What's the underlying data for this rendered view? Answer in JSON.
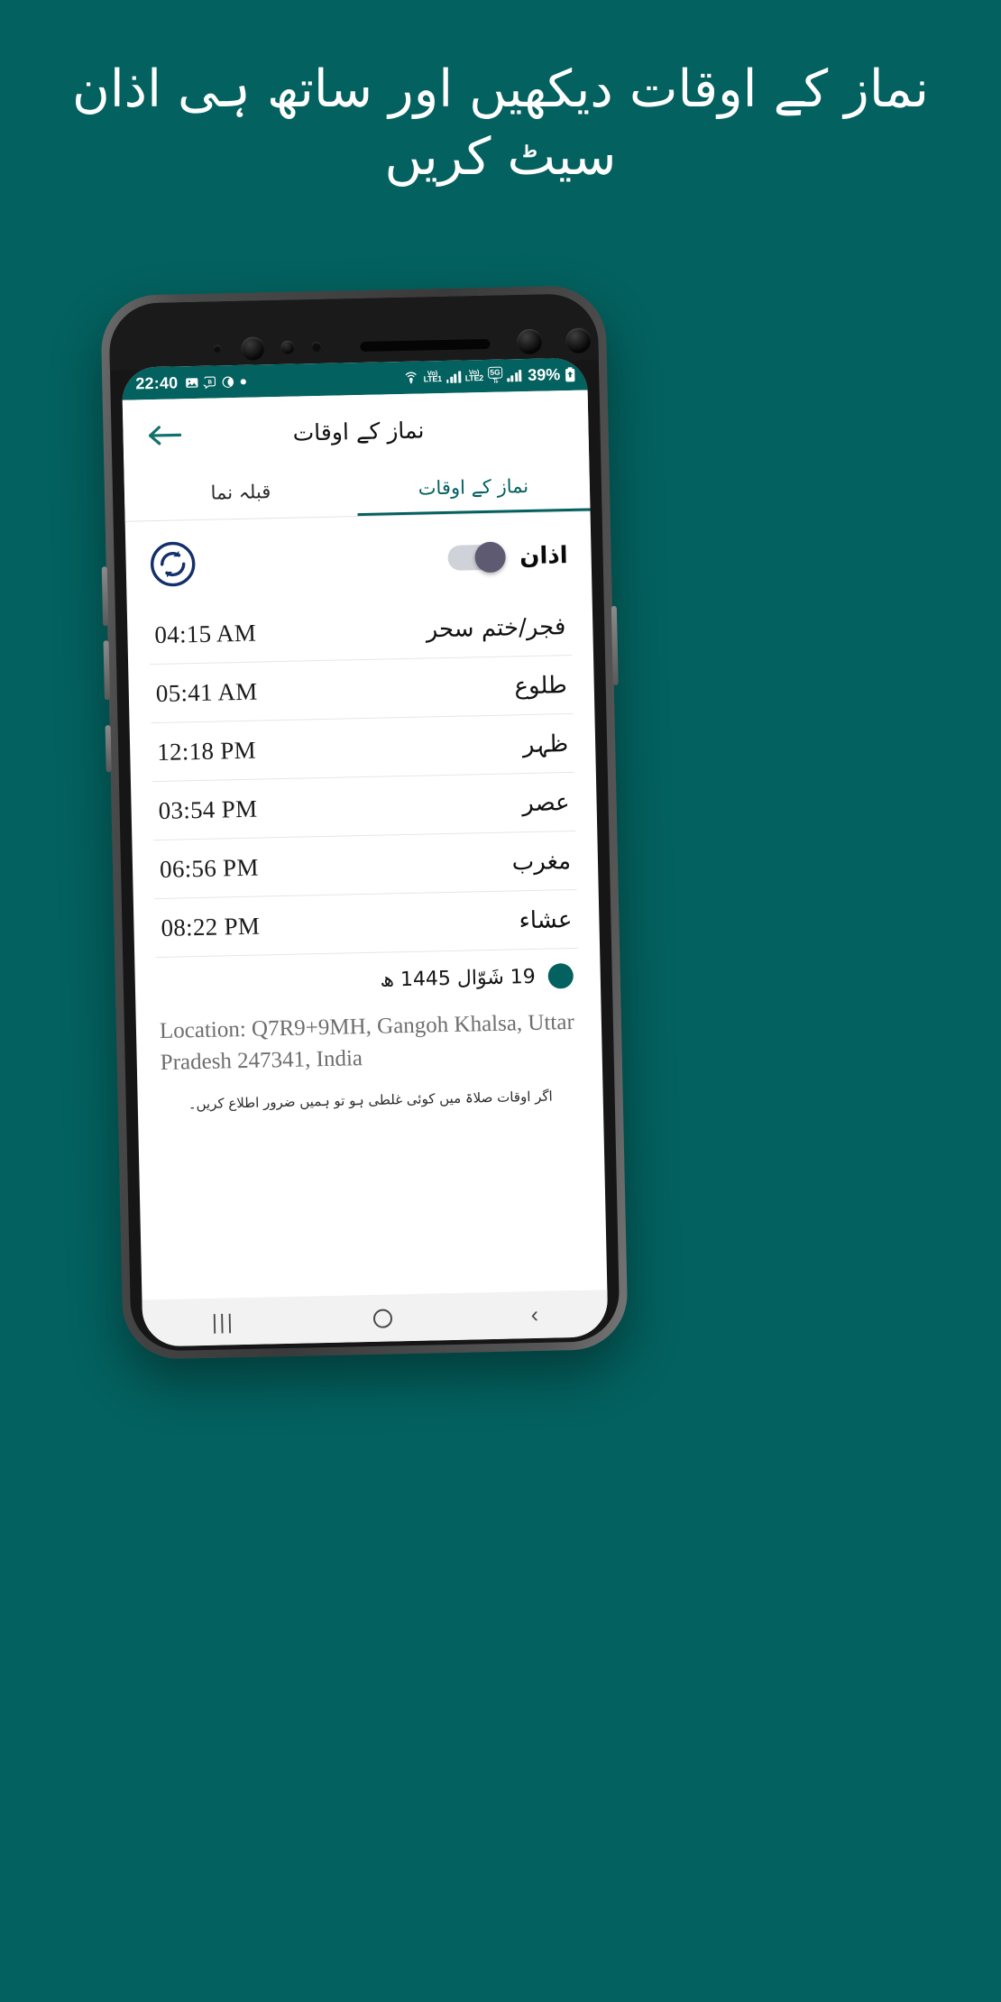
{
  "promo": {
    "headline": "نماز کے اوقات دیکھیں اور ساتھ ہی اذان سیٹ کریں",
    "background_color": "#03615f"
  },
  "statusbar": {
    "clock": "22:40",
    "left_icons": [
      "image-icon",
      "b-badge-icon",
      "moon-icon",
      "dot-icon"
    ],
    "network_1": {
      "line1": "Vo)",
      "line2": "LTE1"
    },
    "network_2": {
      "line1": "Vo)",
      "line2": "LTE2"
    },
    "data_badge": "5G",
    "battery_percent": "39%",
    "right_icons": [
      "hotspot-icon",
      "signal-bars-icon",
      "battery-icon"
    ]
  },
  "appbar": {
    "title": "نماز کے اوقات",
    "back_icon": "arrow-left-icon"
  },
  "tabs": [
    {
      "label": "نماز کے اوقات",
      "active": true
    },
    {
      "label": "قبلہ نما",
      "active": false
    }
  ],
  "azan": {
    "label": "اذان",
    "toggle_state": "on",
    "refresh_icon": "refresh-sync-icon"
  },
  "prayers": [
    {
      "name": "فجر/ختم سحر",
      "time": "04:15 AM"
    },
    {
      "name": "طلوع",
      "time": "05:41 AM"
    },
    {
      "name": "ظہر",
      "time": "12:18 PM"
    },
    {
      "name": "عصر",
      "time": "03:54 PM"
    },
    {
      "name": "مغرب",
      "time": "06:56 PM"
    },
    {
      "name": "عشاء",
      "time": "08:22 PM"
    }
  ],
  "hijri": {
    "date": "19 شَوّال 1445 ھ"
  },
  "location": {
    "text": "Location: Q7R9+9MH, Gangoh Khalsa, Uttar Pradesh 247341, India"
  },
  "note": {
    "text": "اگر اوقات صلاۃ میں کوئی غلطی ہو تو ہمیں ضرور اطلاع کریں۔"
  },
  "navbar": {
    "recents": "|||",
    "home_icon": "home-circle-icon",
    "back_icon": "nav-back-chevron-icon"
  },
  "colors": {
    "brand": "#03615f",
    "toggle_thumb": "#5d5a72",
    "toggle_track": "#cfd2d8"
  }
}
